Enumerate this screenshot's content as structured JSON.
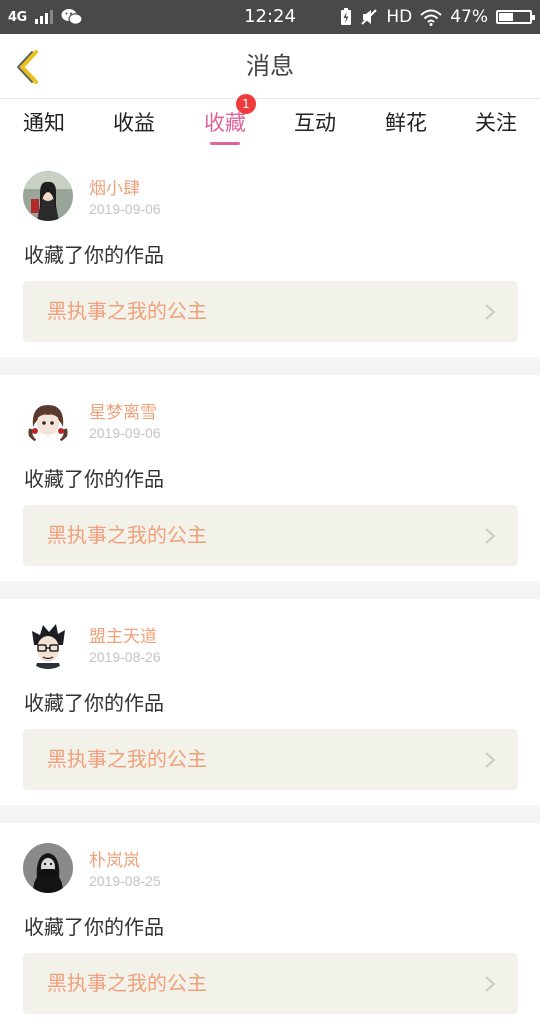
{
  "status_bar": {
    "network": "4G",
    "time": "12:24",
    "hd": "HD",
    "battery": "47%",
    "battery_level": 0.47
  },
  "header": {
    "title": "消息"
  },
  "tabs": [
    {
      "label": "通知"
    },
    {
      "label": "收益"
    },
    {
      "label": "收藏",
      "active": true,
      "badge": "1"
    },
    {
      "label": "互动"
    },
    {
      "label": "鲜花"
    },
    {
      "label": "关注"
    }
  ],
  "items": [
    {
      "user": "烟小肆",
      "date": "2019-09-06",
      "action": "收藏了你的作品",
      "work": "黑执事之我的公主"
    },
    {
      "user": "星梦离雪",
      "date": "2019-09-06",
      "action": "收藏了你的作品",
      "work": "黑执事之我的公主"
    },
    {
      "user": "盟主天道",
      "date": "2019-08-26",
      "action": "收藏了你的作品",
      "work": "黑执事之我的公主"
    },
    {
      "user": "朴岚岚",
      "date": "2019-08-25",
      "action": "收藏了你的作品",
      "work": "黑执事之我的公主"
    }
  ],
  "colors": {
    "accent": "#e0649a",
    "link_text": "#f0a07a",
    "badge": "#ef3b3b",
    "back_arrow": "#e8c21a"
  }
}
